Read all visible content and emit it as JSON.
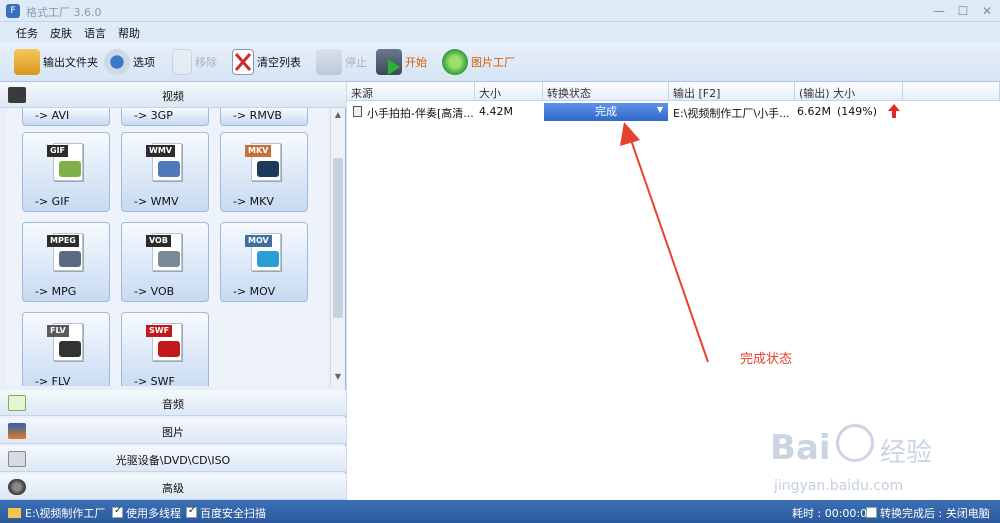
{
  "window": {
    "title": "格式工厂 3.6.0",
    "controls": [
      "—",
      "☐",
      "✕"
    ]
  },
  "menu": [
    "任务",
    "皮肤",
    "语言",
    "帮助"
  ],
  "toolbar": {
    "output_folder": "输出文件夹",
    "options": "选项",
    "remove": "移除",
    "clear_list": "清空列表",
    "stop": "停止",
    "start": "开始",
    "picture_factory": "图片工厂"
  },
  "left_panel": {
    "video_header": "视频",
    "partial_row": [
      "-> AVI",
      "-> 3GP",
      "-> RMVB"
    ],
    "tiles": [
      {
        "badge": "GIF",
        "label": "-> GIF",
        "badge_color": "#2c2c2c",
        "pic_color": "#7fb04a"
      },
      {
        "badge": "WMV",
        "label": "-> WMV",
        "badge_color": "#2c2c2c",
        "pic_color": "#4f79b9"
      },
      {
        "badge": "MKV",
        "label": "-> MKV",
        "badge_color": "#c8703a",
        "pic_color": "#1e3a5a"
      },
      {
        "badge": "MPEG",
        "label": "-> MPG",
        "badge_color": "#2c2c2c",
        "pic_color": "#5a6a80"
      },
      {
        "badge": "VOB",
        "label": "-> VOB",
        "badge_color": "#2c2c2c",
        "pic_color": "#7a8a98"
      },
      {
        "badge": "MOV",
        "label": "-> MOV",
        "badge_color": "#3f6f9f",
        "pic_color": "#2a9fd6"
      },
      {
        "badge": "FLV",
        "label": "-> FLV",
        "badge_color": "#5a5a5a",
        "pic_color": "#333333"
      },
      {
        "badge": "SWF",
        "label": "-> SWF",
        "badge_color": "#c21a1a",
        "pic_color": "#c21a1a"
      }
    ],
    "categories": [
      "音频",
      "图片",
      "光驱设备\\DVD\\CD\\ISO",
      "高级"
    ]
  },
  "table": {
    "columns": [
      "来源",
      "大小",
      "转换状态",
      "输出 [F2]",
      "(输出) 大小"
    ],
    "rows": [
      {
        "source": "小手拍拍-伴奏[高清...",
        "size": "4.42M",
        "status": "完成",
        "output": "E:\\视频制作工厂\\小手...",
        "output_size": "6.62M",
        "ratio": "(149%)"
      }
    ]
  },
  "annotation": {
    "text": "完成状态",
    "color": "#e8412e"
  },
  "statusbar": {
    "path": "E:\\视频制作工厂",
    "multithread": "使用多线程",
    "safe_scan": "百度安全扫描",
    "elapsed": "耗时 : 00:00:05",
    "after_done": "转换完成后 : 关闭电脑"
  },
  "watermark": {
    "brand_left": "Bai",
    "brand_right": "经验",
    "url": "jingyan.baidu.com"
  }
}
